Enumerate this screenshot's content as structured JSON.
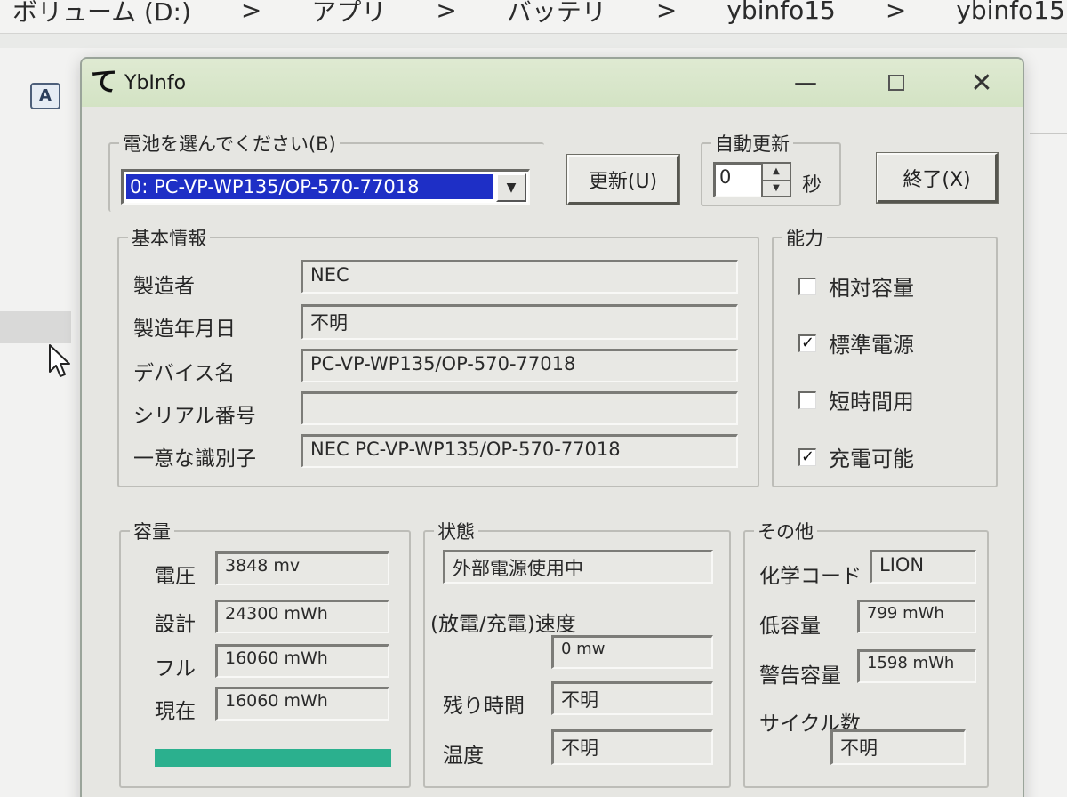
{
  "background_window": {
    "breadcrumb": [
      "ボリューム (D:)",
      ">",
      "アプリ",
      ">",
      "バッテリ",
      ">",
      "ybinfo15",
      ">",
      "ybinfo15"
    ],
    "icon_label": "A"
  },
  "window": {
    "app_icon_glyph": "て",
    "title": "YbInfo",
    "minimize_glyph": "—",
    "close_glyph": "✕"
  },
  "battery_select": {
    "legend": "電池を選んでください(B)",
    "value": "0: PC-VP-WP135/OP-570-77018",
    "arrow_glyph": "▼"
  },
  "update_button": {
    "label": "更新(U)"
  },
  "auto_update": {
    "legend": "自動更新",
    "value": "0",
    "unit": "秒",
    "up_glyph": "▲",
    "down_glyph": "▼"
  },
  "exit_button": {
    "label": "終了(X)"
  },
  "basic_info": {
    "legend": "基本情報",
    "rows": [
      {
        "label": "製造者",
        "value": "NEC"
      },
      {
        "label": "製造年月日",
        "value": "不明"
      },
      {
        "label": "デバイス名",
        "value": "PC-VP-WP135/OP-570-77018"
      },
      {
        "label": "シリアル番号",
        "value": ""
      },
      {
        "label": "一意な識別子",
        "value": "NEC  PC-VP-WP135/OP-570-77018"
      }
    ]
  },
  "capabilities": {
    "legend": "能力",
    "items": [
      {
        "label": "相対容量",
        "checked": false,
        "mark": ""
      },
      {
        "label": "標準電源",
        "checked": true,
        "mark": "✓"
      },
      {
        "label": "短時間用",
        "checked": false,
        "mark": ""
      },
      {
        "label": "充電可能",
        "checked": true,
        "mark": "✓"
      }
    ]
  },
  "capacity": {
    "legend": "容量",
    "rows": [
      {
        "label": "電圧",
        "value": "3848 mv"
      },
      {
        "label": "設計",
        "value": "24300 mWh"
      },
      {
        "label": "フル",
        "value": "16060 mWh"
      },
      {
        "label": "現在",
        "value": "16060 mWh"
      }
    ],
    "charge_fraction": 1.0,
    "bar_color": "#2bb08e"
  },
  "status": {
    "legend": "状態",
    "power_state": "外部電源使用中",
    "rate_label": "(放電/充電)速度",
    "rate_value": "0 mw",
    "remaining_label": "残り時間",
    "remaining_value": "不明",
    "temp_label": "温度",
    "temp_value": "不明"
  },
  "other": {
    "legend": "その他",
    "chem_label": "化学コード",
    "chem_value": "LION",
    "low_label": "低容量",
    "low_value": "799 mWh",
    "warn_label": "警告容量",
    "warn_value": "1598 mWh",
    "cycle_label": "サイクル数",
    "cycle_value": "不明"
  }
}
